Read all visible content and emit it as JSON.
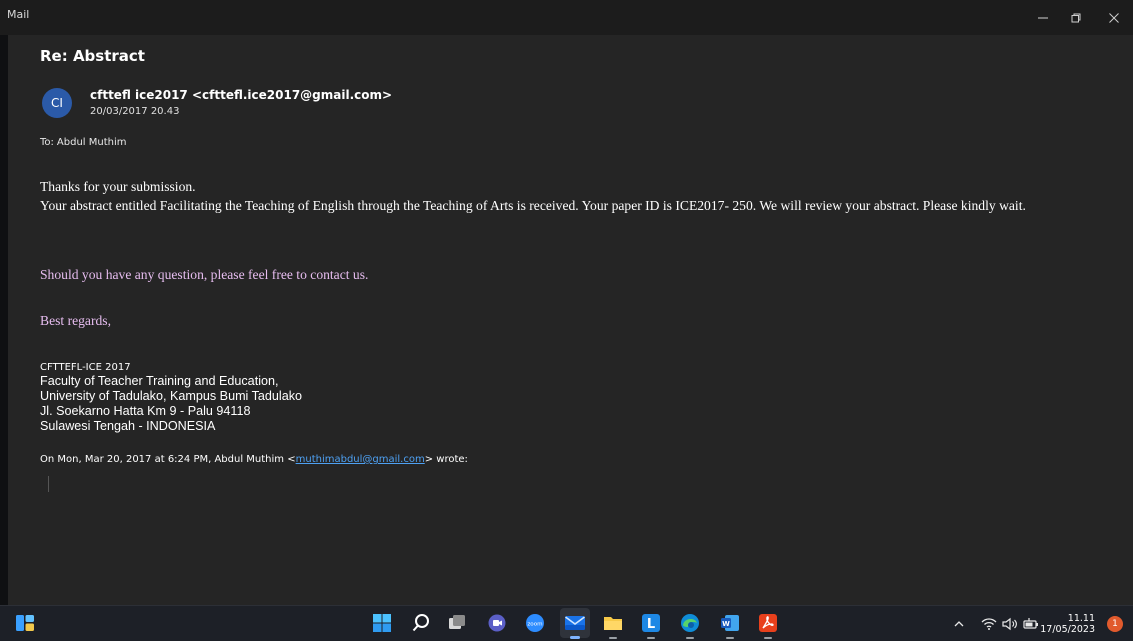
{
  "window": {
    "app_title": "Mail"
  },
  "email": {
    "subject": "Re: Abstract",
    "avatar_initials": "CI",
    "sender": "cfttefl ice2017 <cfttefl.ice2017@gmail.com>",
    "date": "20/03/2017 20.43",
    "to_label": "To:",
    "to_value": "Abdul Muthim",
    "body_line1": "Thanks for your submission.",
    "body_line2": "Your abstract entitled Facilitating the Teaching of English through the Teaching of Arts is received. Your paper ID is ICE2017- 250. We will review your abstract. Please kindly wait.",
    "body_line3": "Should you have any question, please feel free to contact us.",
    "body_line4": "Best regards,",
    "signature": {
      "org": "CFTTEFL-ICE 2017",
      "line1": "Faculty of Teacher Training and Education,",
      "line2": "University of Tadulako, Kampus Bumi Tadulako",
      "line3": "Jl. Soekarno Hatta Km 9 - Palu 94118",
      "line4": "Sulawesi Tengah - INDONESIA"
    },
    "quote_prefix": "On Mon, Mar 20, 2017 at 6:24 PM, Abdul Muthim <",
    "quote_email": "muthimabdul@gmail.com",
    "quote_suffix": "> wrote:"
  },
  "colors": {
    "accent_pink": "#e7bdf0",
    "link_blue": "#4ea1f3",
    "avatar_blue": "#2b5aa8"
  },
  "taskbar": {
    "icons": [
      "widgets-icon",
      "start-icon",
      "search-icon",
      "task-view-icon",
      "chat-icon",
      "zoom-icon",
      "mail-icon",
      "file-explorer-icon",
      "l-app-icon",
      "edge-icon",
      "word-icon",
      "acrobat-icon"
    ],
    "time": "11.11",
    "date": "17/05/2023",
    "notification_count": "1"
  }
}
